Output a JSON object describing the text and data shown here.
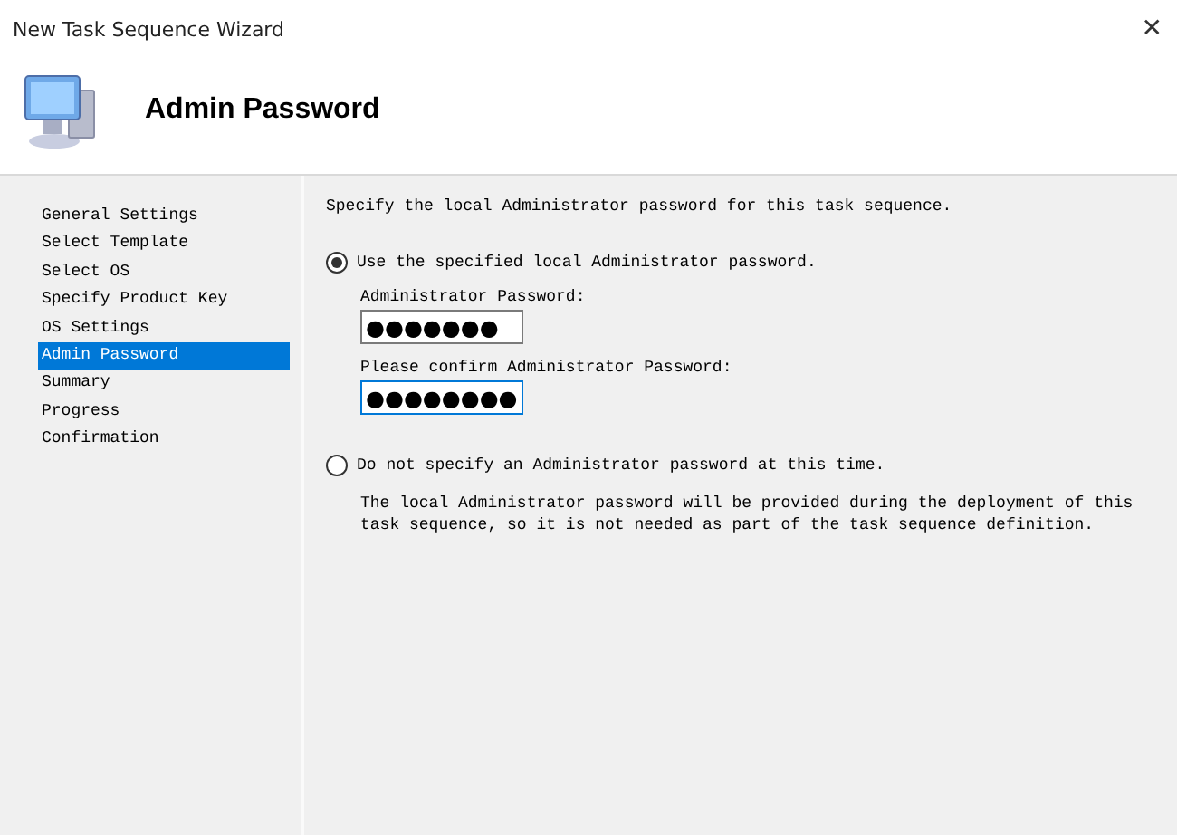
{
  "window": {
    "title": "New Task Sequence Wizard",
    "close": "✕"
  },
  "header": {
    "title": "Admin Password"
  },
  "nav": [
    {
      "label": "General Settings",
      "selected": false
    },
    {
      "label": "Select Template",
      "selected": false
    },
    {
      "label": "Select OS",
      "selected": false
    },
    {
      "label": "Specify Product Key",
      "selected": false
    },
    {
      "label": "OS Settings",
      "selected": false
    },
    {
      "label": "Admin Password",
      "selected": true
    },
    {
      "label": "Summary",
      "selected": false
    },
    {
      "label": "Progress",
      "selected": false
    },
    {
      "label": "Confirmation",
      "selected": false
    }
  ],
  "intro": "Specify the local Administrator password for this task sequence.",
  "options": [
    {
      "label": "Use the specified local Administrator password.",
      "selected": true,
      "fields": [
        {
          "label": "Administrator Password:",
          "value": "●●●●●●●",
          "focused": false
        },
        {
          "label": "Please confirm Administrator Password:",
          "value": "●●●●●●●●",
          "focused": true
        }
      ]
    },
    {
      "label": "Do not specify an Administrator password at this time.",
      "selected": false,
      "note": "The local Administrator password will be provided during the deployment of this task sequence, so it is not needed as part of the task sequence definition."
    }
  ]
}
